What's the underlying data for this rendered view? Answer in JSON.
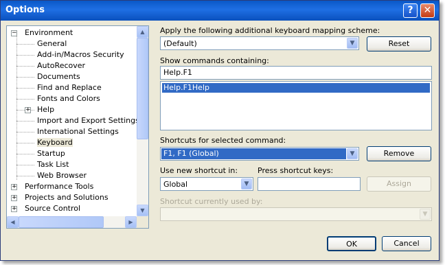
{
  "window": {
    "title": "Options"
  },
  "titlebar": {
    "help_glyph": "?",
    "close_glyph": "✕"
  },
  "tree": {
    "items": [
      {
        "label": "Environment",
        "level": 0,
        "expander": "minus"
      },
      {
        "label": "General",
        "level": 1
      },
      {
        "label": "Add-in/Macros Security",
        "level": 1
      },
      {
        "label": "AutoRecover",
        "level": 1
      },
      {
        "label": "Documents",
        "level": 1
      },
      {
        "label": "Find and Replace",
        "level": 1
      },
      {
        "label": "Fonts and Colors",
        "level": 1
      },
      {
        "label": "Help",
        "level": 1,
        "expander": "plus"
      },
      {
        "label": "Import and Export Settings",
        "level": 1
      },
      {
        "label": "International Settings",
        "level": 1
      },
      {
        "label": "Keyboard",
        "level": 1,
        "selected": true
      },
      {
        "label": "Startup",
        "level": 1
      },
      {
        "label": "Task List",
        "level": 1
      },
      {
        "label": "Web Browser",
        "level": 1
      },
      {
        "label": "Performance Tools",
        "level": 0,
        "expander": "plus"
      },
      {
        "label": "Projects and Solutions",
        "level": 0,
        "expander": "plus"
      },
      {
        "label": "Source Control",
        "level": 0,
        "expander": "plus"
      }
    ]
  },
  "mapping": {
    "label": "Apply the following additional keyboard mapping scheme:",
    "value": "(Default)",
    "reset_label": "Reset"
  },
  "commands": {
    "label": "Show commands containing:",
    "filter_value": "Help.F1",
    "list": [
      "Help.F1Help"
    ]
  },
  "shortcuts": {
    "label": "Shortcuts for selected command:",
    "value": "F1, F1 (Global)",
    "remove_label": "Remove"
  },
  "new_shortcut": {
    "label": "Use new shortcut in:",
    "value": "Global",
    "press_label": "Press shortcut keys:",
    "press_value": "",
    "assign_label": "Assign"
  },
  "used_by": {
    "label": "Shortcut currently used by:",
    "value": ""
  },
  "footer": {
    "ok_label": "OK",
    "cancel_label": "Cancel"
  }
}
